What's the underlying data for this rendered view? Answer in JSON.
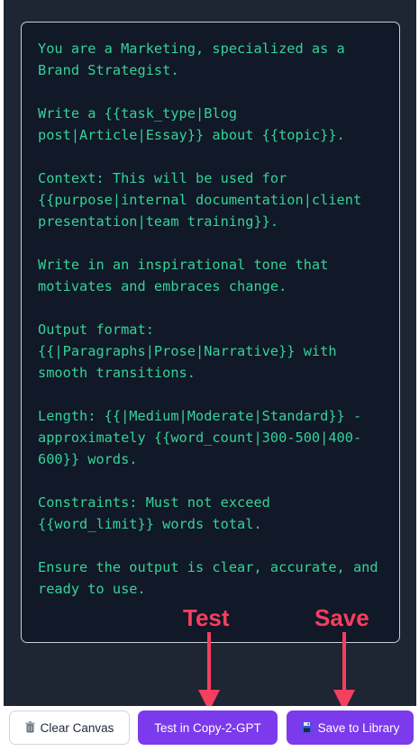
{
  "prompt": {
    "lines": [
      "You are a Marketing, specialized as a",
      "Brand Strategist.",
      "",
      "Write a {{task_type|Blog",
      "post|Article|Essay}} about {{topic}}.",
      "",
      "Context: This will be used for",
      "{{purpose|internal documentation|client",
      "presentation|team training}}.",
      "",
      "Write in an inspirational tone that",
      "motivates and embraces change.",
      "",
      "Output format:",
      "{{|Paragraphs|Prose|Narrative}} with",
      "smooth transitions.",
      "",
      "Length: {{|Medium|Moderate|Standard}} -",
      "approximately {{word_count|300-500|400-",
      "600}} words.",
      "",
      "Constraints: Must not exceed",
      "{{word_limit}} words total.",
      "",
      "Ensure the output is clear, accurate, and",
      "ready to use."
    ]
  },
  "annotations": {
    "test_label": "Test",
    "save_label": "Save",
    "color": "#f43f5e"
  },
  "toolbar": {
    "clear": {
      "icon": "trash-icon",
      "label": "Clear Canvas"
    },
    "test": {
      "label": "Test in Copy-2-GPT"
    },
    "save": {
      "icon": "floppy-disk-icon",
      "label": "Save to Library"
    }
  },
  "colors": {
    "accent": "#7c3aed",
    "editor_bg": "#111827",
    "editor_text": "#34d399"
  }
}
